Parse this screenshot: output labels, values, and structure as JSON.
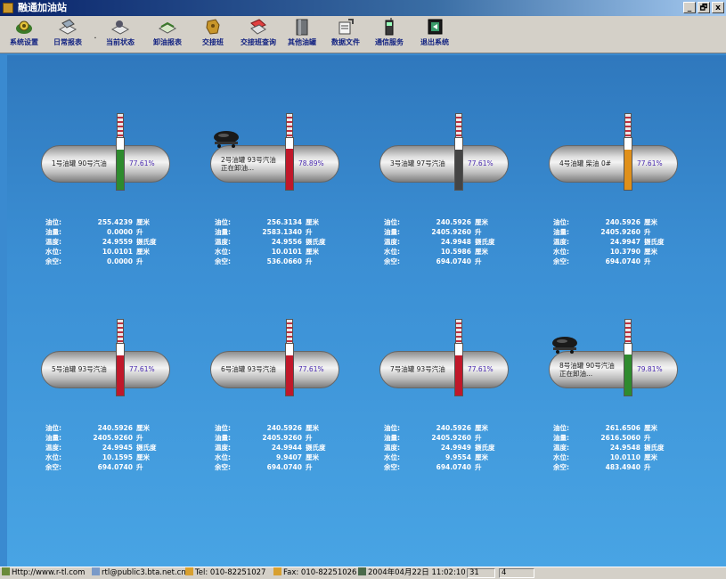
{
  "window": {
    "title": "融通加油站",
    "controls": [
      "_",
      "🗗",
      "x"
    ]
  },
  "toolbar": [
    {
      "label": "系统设置",
      "icon": "gear-icon"
    },
    {
      "label": "日常报表",
      "icon": "report-icon"
    },
    {
      "label": "当前状态",
      "icon": "status-icon"
    },
    {
      "label": "卸油报表",
      "icon": "unload-report-icon"
    },
    {
      "label": "交接班",
      "icon": "shift-icon"
    },
    {
      "label": "交接班查询",
      "icon": "shift-query-icon"
    },
    {
      "label": "其他油罐",
      "icon": "tank-icon"
    },
    {
      "label": "数据文件",
      "icon": "data-file-icon"
    },
    {
      "label": "通信服务",
      "icon": "phone-icon"
    },
    {
      "label": "退出系统",
      "icon": "exit-icon"
    }
  ],
  "tank_labels": [
    "油位:",
    "油量:",
    "温度:",
    "水位:",
    "余空:"
  ],
  "units": [
    "厘米",
    "升",
    "摄氏度",
    "厘米",
    "升"
  ],
  "tanks": [
    {
      "name": "1号油罐 90号汽油",
      "status": "",
      "percent": "77.61%",
      "level": 0.78,
      "color": "#2e8b2e",
      "truck": false,
      "values": [
        "255.4239",
        "0.0000",
        "24.9559",
        "10.0101",
        "0.0000"
      ]
    },
    {
      "name": "2号油罐 93号汽油",
      "status": "正在卸油...",
      "percent": "78.89%",
      "level": 0.79,
      "color": "#c0182a",
      "truck": true,
      "values": [
        "256.3134",
        "2583.1340",
        "24.9556",
        "10.0101",
        "536.0660"
      ]
    },
    {
      "name": "3号油罐 97号汽油",
      "status": "",
      "percent": "77.61%",
      "level": 0.78,
      "color": "#444444",
      "truck": false,
      "values": [
        "240.5926",
        "2405.9260",
        "24.9948",
        "10.5986",
        "694.0740"
      ]
    },
    {
      "name": "4号油罐 柴油 0#",
      "status": "",
      "percent": "77.61%",
      "level": 0.78,
      "color": "#e0901a",
      "truck": false,
      "values": [
        "240.5926",
        "2405.9260",
        "24.9947",
        "10.3790",
        "694.0740"
      ]
    },
    {
      "name": "5号油罐 93号汽油",
      "status": "",
      "percent": "77.61%",
      "level": 0.78,
      "color": "#c0182a",
      "truck": false,
      "values": [
        "240.5926",
        "2405.9260",
        "24.9945",
        "10.1595",
        "694.0740"
      ]
    },
    {
      "name": "6号油罐 93号汽油",
      "status": "",
      "percent": "77.61%",
      "level": 0.78,
      "color": "#c0182a",
      "truck": false,
      "values": [
        "240.5926",
        "2405.9260",
        "24.9944",
        "9.9407",
        "694.0740"
      ]
    },
    {
      "name": "7号油罐 93号汽油",
      "status": "",
      "percent": "77.61%",
      "level": 0.78,
      "color": "#c0182a",
      "truck": false,
      "values": [
        "240.5926",
        "2405.9260",
        "24.9949",
        "9.9554",
        "694.0740"
      ]
    },
    {
      "name": "8号油罐 90号汽油",
      "status": "正在卸油...",
      "percent": "79.81%",
      "level": 0.8,
      "color": "#2e8b2e",
      "truck": true,
      "values": [
        "261.6506",
        "2616.5060",
        "24.9548",
        "10.0110",
        "483.4940"
      ]
    }
  ],
  "statusbar": {
    "website": "Http://www.r-tl.com",
    "email": "rtl@public3.bta.net.cn",
    "tel": "Tel: 010-82251027",
    "fax": "Fax: 010-82251026",
    "datetime": "2004年04月22日 11:02:10",
    "field1": "31",
    "field2": "4"
  }
}
